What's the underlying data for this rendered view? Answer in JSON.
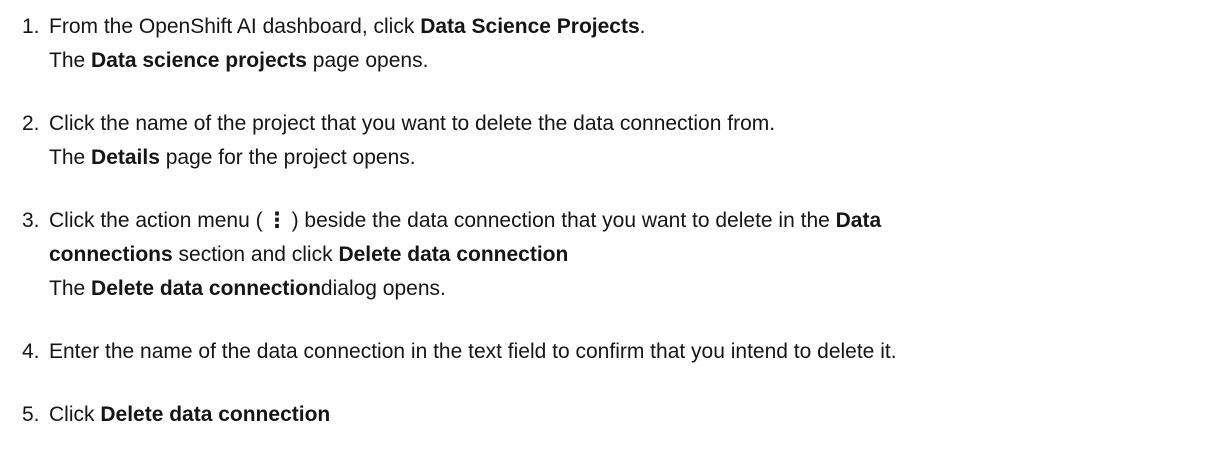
{
  "steps": [
    {
      "num": "1.",
      "line1": {
        "t1": "From the OpenShift AI dashboard, click ",
        "b1": "Data Science Projects",
        "t2": "."
      },
      "line2": {
        "t1": "The ",
        "b1": "Data science projects",
        "t2": " page opens."
      }
    },
    {
      "num": "2.",
      "line1": {
        "t1": "Click the name of the project that you want to delete the data connection from."
      },
      "line2": {
        "t1": "The ",
        "b1": "Details",
        "t2": " page for the project opens."
      }
    },
    {
      "num": "3.",
      "line1": {
        "t1": "Click the action menu (",
        "kebab": "⋮",
        "t2": ") beside the data connection that you want to delete in the ",
        "b1": "Data"
      },
      "line2": {
        "b1": "connections",
        "t1": " section and click ",
        "b2": "Delete data connection"
      },
      "line3": {
        "t1": "The ",
        "b1": "Delete data connection",
        "t2": "dialog opens."
      }
    },
    {
      "num": "4.",
      "line1": {
        "t1": "Enter the name of the data connection in the text field to confirm that you intend to delete it."
      }
    },
    {
      "num": "5.",
      "line1": {
        "t1": "Click ",
        "b1": "Delete data connection"
      }
    }
  ]
}
